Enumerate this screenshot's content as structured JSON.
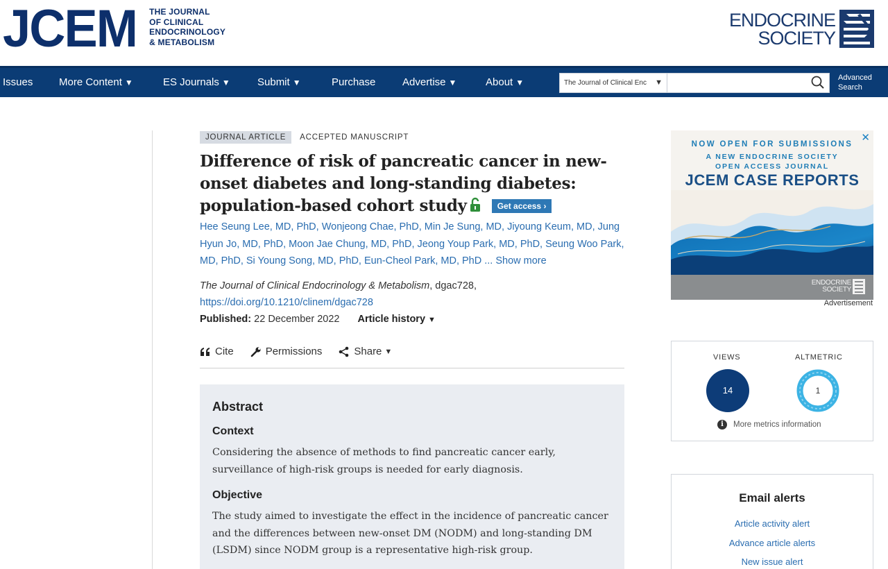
{
  "header": {
    "logo_word": "JCEM",
    "logo_sub": [
      "THE JOURNAL",
      "OF CLINICAL",
      "ENDOCRINOLOGY",
      "& METABOLISM"
    ],
    "society_line1": "ENDOCRINE",
    "society_line2": "SOCIETY"
  },
  "nav": {
    "items": [
      {
        "label": "Issues"
      },
      {
        "label": "More Content",
        "caret": "▼"
      },
      {
        "label": "ES Journals",
        "caret": "▼"
      },
      {
        "label": "Submit",
        "caret": "▼"
      },
      {
        "label": "Purchase"
      },
      {
        "label": "Advertise",
        "caret": "▼"
      },
      {
        "label": "About",
        "caret": "▼"
      }
    ],
    "search_scope": "The Journal of Clinical Enc",
    "search_placeholder": "",
    "advanced_search_line1": "Advanced",
    "advanced_search_line2": "Search"
  },
  "article": {
    "type_badge": "JOURNAL ARTICLE",
    "status": "ACCEPTED MANUSCRIPT",
    "title": "Difference of risk of pancreatic cancer in new-onset diabetes and long-standing diabetes: population-based cohort study",
    "get_access": "Get access",
    "authors": [
      "Hee Seung Lee, MD, PhD",
      "Wonjeong Chae, PhD",
      "Min Je Sung, MD",
      "Jiyoung Keum, MD",
      "Jung Hyun Jo, MD, PhD",
      "Moon Jae Chung, MD, PhD",
      "Jeong Youp Park, MD, PhD",
      "Seung Woo Park, MD, PhD",
      "Si Young Song, MD, PhD",
      "Eun-Cheol Park, MD, PhD"
    ],
    "show_more": "... Show more",
    "journal_name": "The Journal of Clinical Endocrinology & Metabolism",
    "article_id": ", dgac728,",
    "doi": "https://doi.org/10.1210/clinem/dgac728",
    "published_label": "Published:",
    "published_date": "22 December 2022",
    "history_label": "Article history",
    "tools": {
      "cite": "Cite",
      "permissions": "Permissions",
      "share": "Share"
    }
  },
  "abstract": {
    "heading": "Abstract",
    "sections": [
      {
        "heading": "Context",
        "text": "Considering the absence of methods to find pancreatic cancer early, surveillance of high-risk groups is needed for early diagnosis."
      },
      {
        "heading": "Objective",
        "text": "The study aimed to investigate the effect in the incidence of pancreatic cancer and the differences between new-onset DM (NODM) and long-standing DM (LSDM) since NODM group is a representative high-risk group."
      }
    ]
  },
  "ad": {
    "line1": "NOW OPEN FOR SUBMISSIONS",
    "line2": "A NEW ENDOCRINE SOCIETY",
    "line3": "OPEN ACCESS JOURNAL",
    "headline": "JCEM CASE REPORTS",
    "footer_line1": "ENDOCRINE",
    "footer_line2": "SOCIETY",
    "close": "✕",
    "label": "Advertisement"
  },
  "metrics": {
    "views_label": "VIEWS",
    "views_value": "14",
    "altmetric_label": "ALTMETRIC",
    "altmetric_value": "1",
    "more_info": "More metrics information"
  },
  "email_alerts": {
    "title": "Email alerts",
    "links": [
      "Article activity alert",
      "Advance article alerts",
      "New issue alert"
    ]
  },
  "colors": {
    "brand_navy": "#0b3c75",
    "link_blue": "#2a6db0",
    "get_access_blue": "#2e78b5",
    "abstract_bg": "#eaedf2"
  }
}
